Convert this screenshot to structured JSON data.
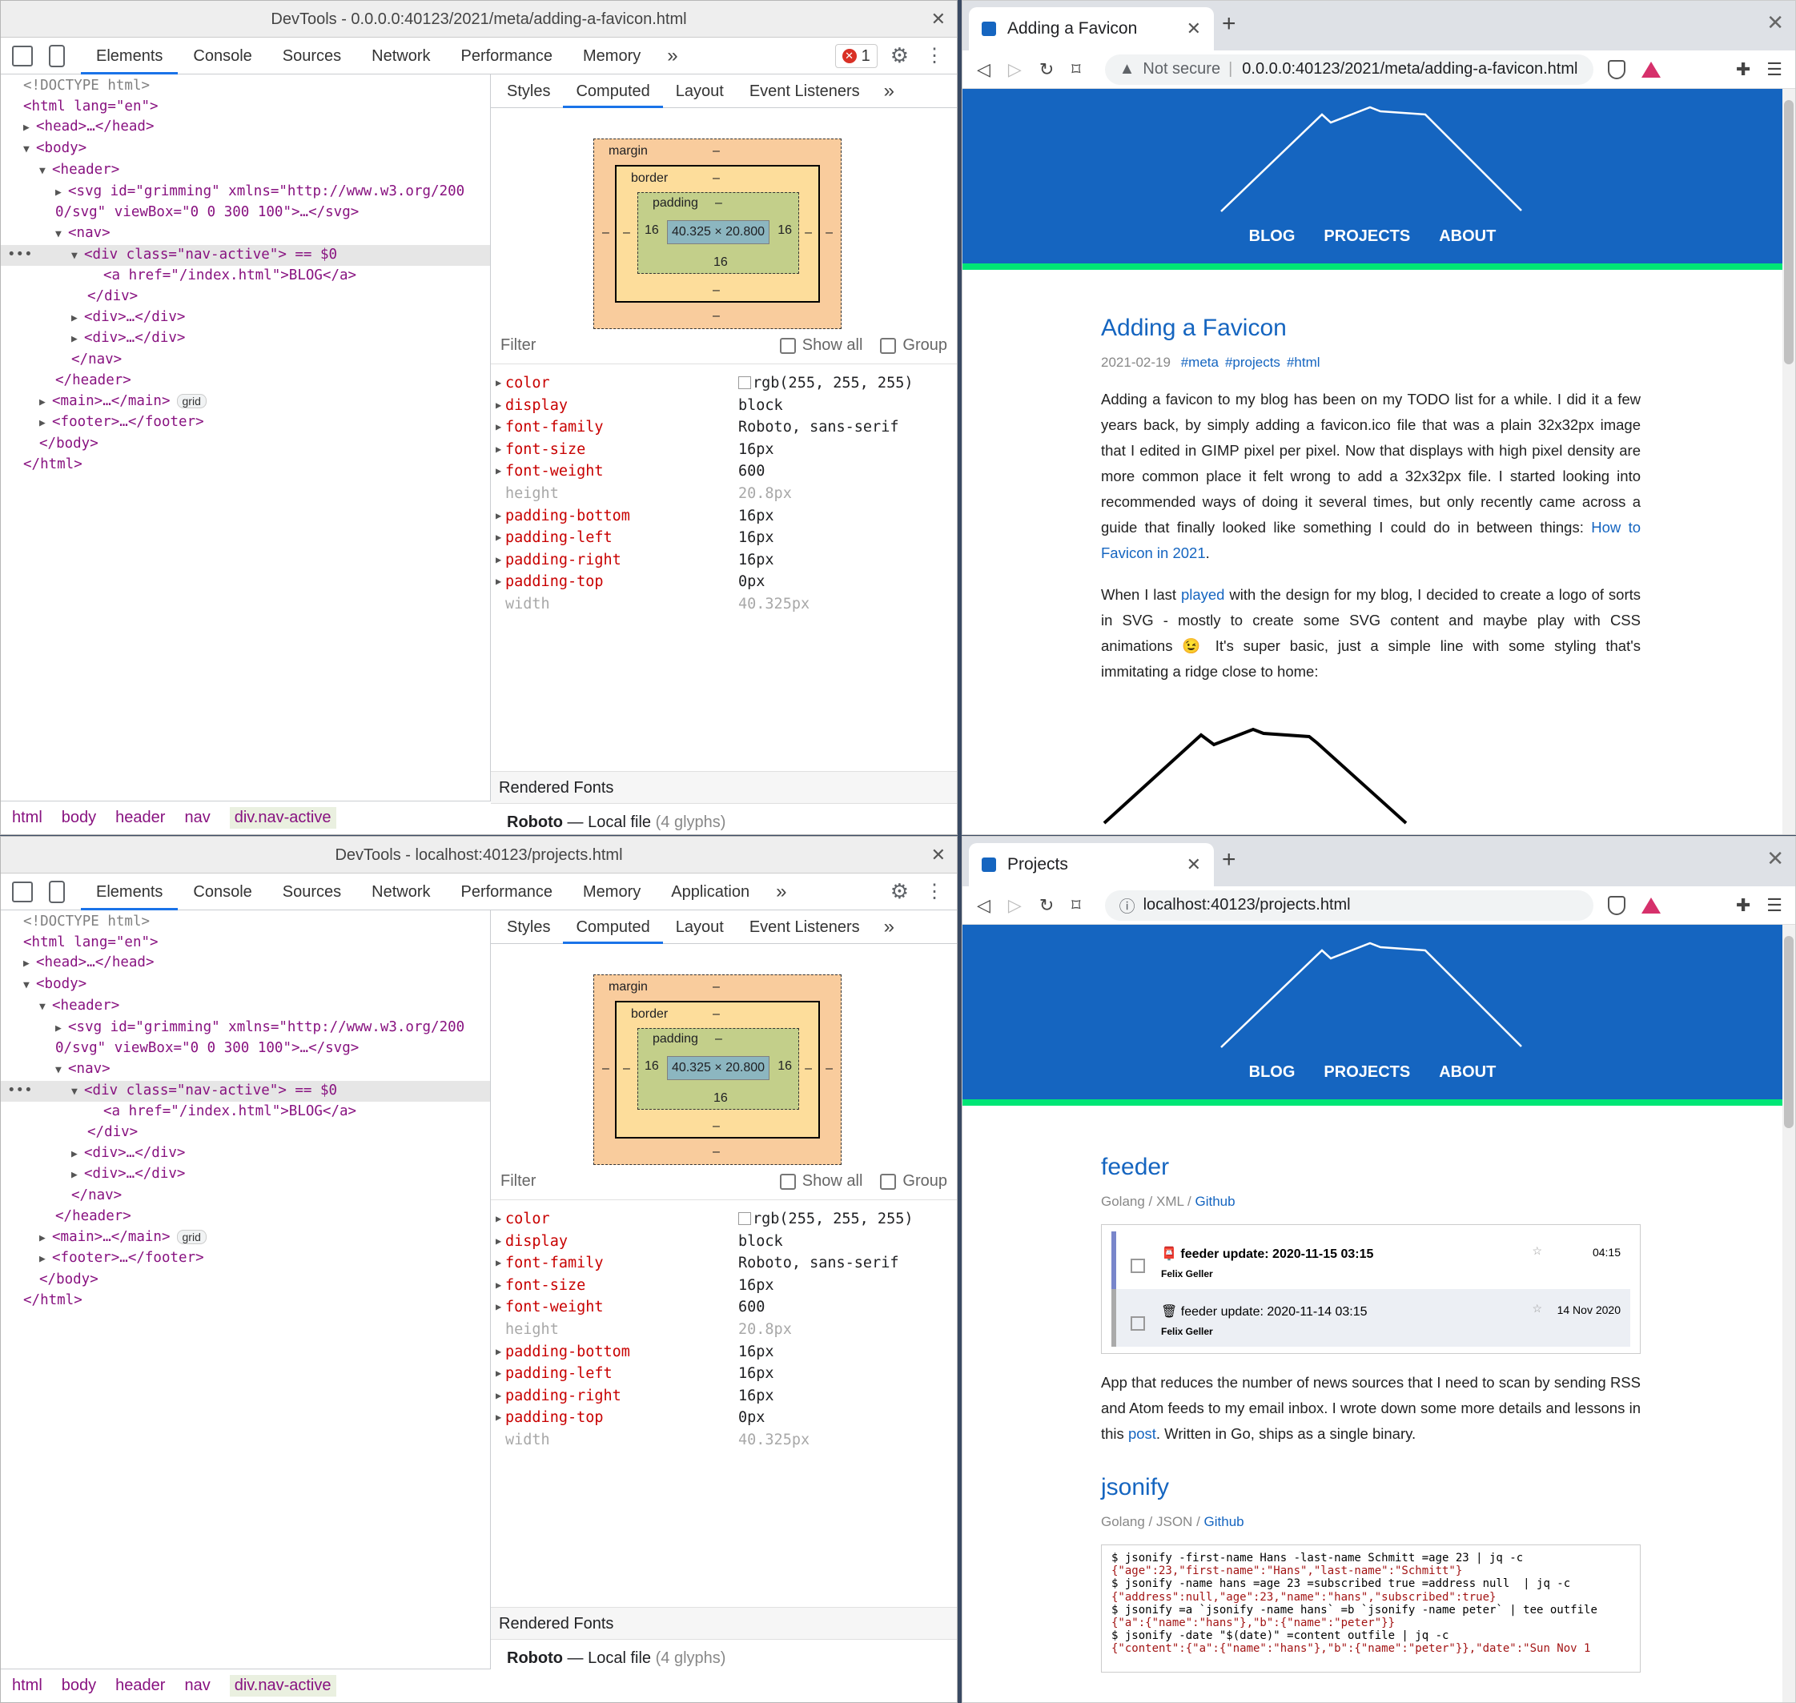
{
  "devtools1": {
    "title": "DevTools - 0.0.0.0:40123/2021/meta/adding-a-favicon.html",
    "tabs": [
      "Elements",
      "Console",
      "Sources",
      "Network",
      "Performance",
      "Memory"
    ],
    "error_count": "1",
    "breadcrumbs": [
      "html",
      "body",
      "header",
      "nav",
      "div.nav-active"
    ]
  },
  "devtools2": {
    "title": "DevTools - localhost:40123/projects.html",
    "tabs": [
      "Elements",
      "Console",
      "Sources",
      "Network",
      "Performance",
      "Memory",
      "Application"
    ],
    "breadcrumbs": [
      "html",
      "body",
      "header",
      "nav",
      "div.nav-active"
    ]
  },
  "sidebar": {
    "tabs": [
      "Styles",
      "Computed",
      "Layout",
      "Event Listeners"
    ],
    "box": {
      "margin": "margin",
      "border": "border",
      "padding": "padding",
      "content": "40.325 × 20.800",
      "dash": "–",
      "pad_lr": "16",
      "pad_b": "16"
    },
    "filter": "Filter",
    "show_all": "Show all",
    "group": "Group",
    "props": [
      {
        "n": "color",
        "v": "rgb(255, 255, 255)",
        "inh": false
      },
      {
        "n": "display",
        "v": "block",
        "inh": false
      },
      {
        "n": "font-family",
        "v": "Roboto, sans-serif",
        "inh": false
      },
      {
        "n": "font-size",
        "v": "16px",
        "inh": false
      },
      {
        "n": "font-weight",
        "v": "600",
        "inh": false
      },
      {
        "n": "height",
        "v": "20.8px",
        "inh": true
      },
      {
        "n": "padding-bottom",
        "v": "16px",
        "inh": false
      },
      {
        "n": "padding-left",
        "v": "16px",
        "inh": false
      },
      {
        "n": "padding-right",
        "v": "16px",
        "inh": false
      },
      {
        "n": "padding-top",
        "v": "0px",
        "inh": false
      },
      {
        "n": "width",
        "v": "40.325px",
        "inh": true
      }
    ],
    "rendered_fonts": "Rendered Fonts",
    "font_name": "Roboto",
    "font_src": "Local file",
    "font_glyphs": "(4 glyphs)"
  },
  "dom": {
    "doctype": "<!DOCTYPE html>",
    "html_open": "<html lang=\"en\">",
    "head": "<head>…</head>",
    "body": "<body>",
    "header": "<header>",
    "svg1": "<svg id=\"grimming\" xmlns=\"http://www.w3.org/200",
    "svg2": "0/svg\" viewBox=\"0 0 300 100\">…</svg>",
    "nav": "<nav>",
    "div_active": "<div class=\"nav-active\"> == $0",
    "a_tag": "<a href=\"/index.html\">BLOG</a>",
    "div_close": "</div>",
    "div_collapsed": "<div>…</div>",
    "nav_close": "</nav>",
    "header_close": "</header>",
    "main": "<main>…</main>",
    "grid": "grid",
    "footer": "<footer>…</footer>",
    "body_close": "</body>",
    "html_close": "</html>"
  },
  "browser1": {
    "tab_title": "Adding a Favicon",
    "not_secure": "Not secure",
    "url": "0.0.0.0:40123/2021/meta/adding-a-favicon.html",
    "nav": [
      "BLOG",
      "PROJECTS",
      "ABOUT"
    ],
    "post_title": "Adding a Favicon",
    "date": "2021-02-19",
    "tags": [
      "#meta",
      "#projects",
      "#html"
    ],
    "p1_a": "Adding a favicon to my blog has been on my TODO list for a while. I did it a few years back, by simply adding a favicon.ico file that was a plain 32x32px image that I edited in GIMP pixel per pixel. Now that displays with high pixel density are more common place it felt wrong to add a 32x32px file. I started looking into recommended ways of doing it several times, but only recently came across a guide that finally looked like something I could do in between things: ",
    "p1_link": "How to Favicon in 2021",
    "p1_end": ".",
    "p2_a": "When I last ",
    "p2_link": "played",
    "p2_b": " with the design for my blog, I decided to create a logo of sorts in SVG - mostly to create some SVG content and maybe play with CSS animations 😉 It's super basic, just a simple line with some styling that's immitating a ridge close to home:"
  },
  "browser2": {
    "tab_title": "Projects",
    "url": "localhost:40123/projects.html",
    "nav": [
      "BLOG",
      "PROJECTS",
      "ABOUT"
    ],
    "proj1": {
      "title": "feeder",
      "lang": "Golang",
      "fmt": "XML",
      "gh": "Github",
      "mail": [
        {
          "subject": "📮 feeder update: 2020-11-15 03:15",
          "from": "Felix Geller",
          "time": "04:15"
        },
        {
          "subject": "🗑 feeder update: 2020-11-14 03:15",
          "from": "Felix Geller",
          "time": "14 Nov 2020"
        }
      ],
      "desc_a": "App that reduces the number of news sources that I need to scan by sending RSS and Atom feeds to my email inbox. I wrote down some more details and lessons in this ",
      "desc_link": "post",
      "desc_b": ". Written in Go, ships as a single binary."
    },
    "proj2": {
      "title": "jsonify",
      "lang": "Golang",
      "fmt": "JSON",
      "gh": "Github",
      "code": [
        "$ jsonify -first-name Hans -last-name Schmitt =age 23 | jq -c",
        "{\"age\":23,\"first-name\":\"Hans\",\"last-name\":\"Schmitt\"}",
        "$ jsonify -name hans =age 23 =subscribed true =address null  | jq -c",
        "{\"address\":null,\"age\":23,\"name\":\"hans\",\"subscribed\":true}",
        "$ jsonify =a `jsonify -name hans` =b `jsonify -name peter` | tee outfile",
        "{\"a\":{\"name\":\"hans\"},\"b\":{\"name\":\"peter\"}}",
        "$ jsonify -date \"$(date)\" =content outfile | jq -c",
        "{\"content\":{\"a\":{\"name\":\"hans\"},\"b\":{\"name\":\"peter\"}},\"date\":\"Sun Nov 1"
      ]
    }
  },
  "colors": {
    "header_blue": "#1565c0",
    "accent_green": "#00e676",
    "link_blue": "#1565c0"
  }
}
